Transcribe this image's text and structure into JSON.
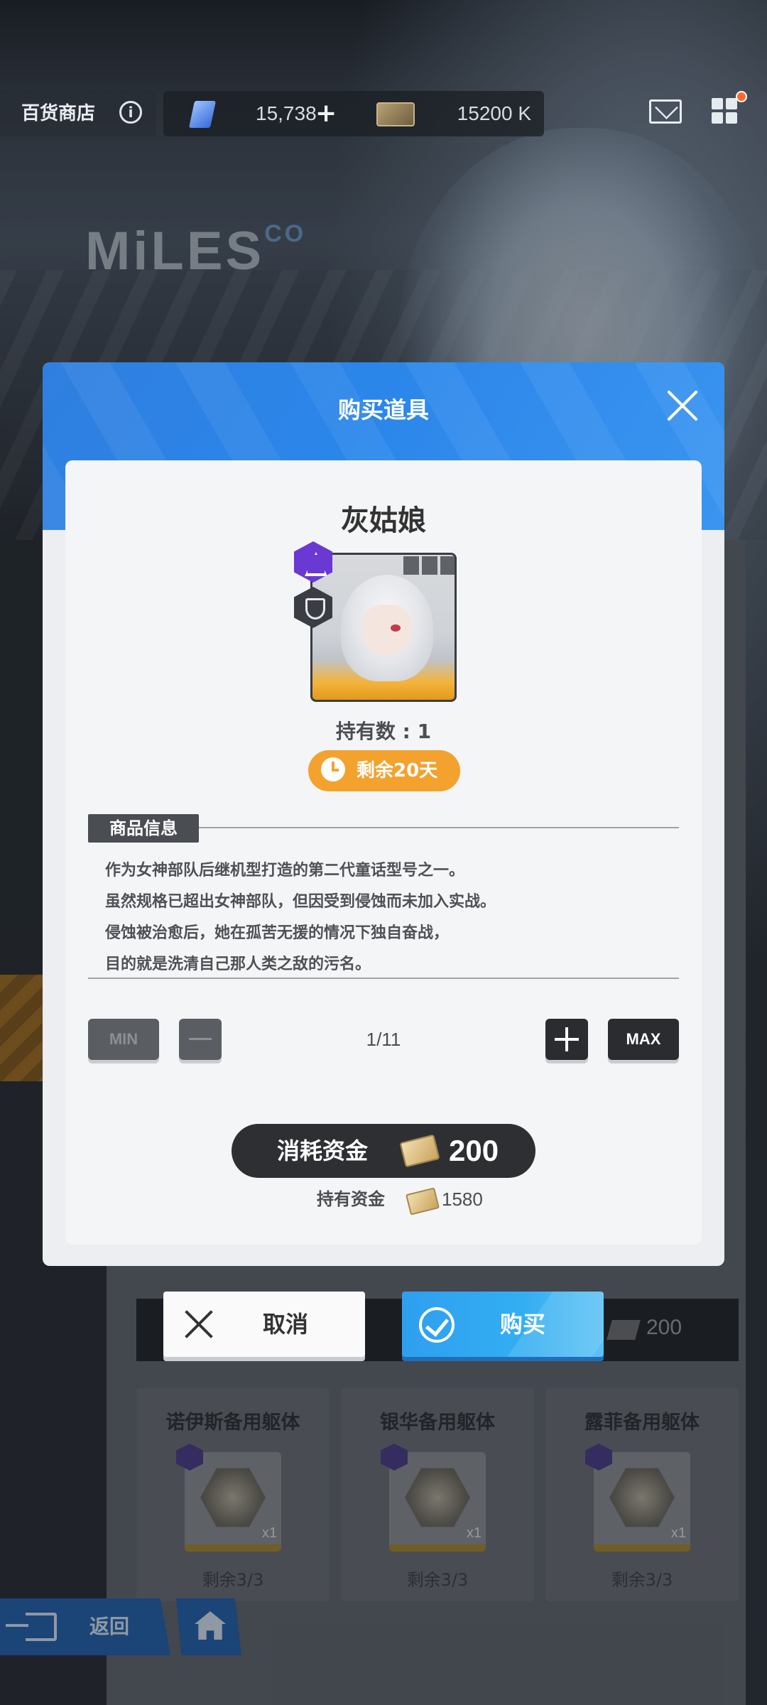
{
  "topbar": {
    "shop_title": "百货商店",
    "gem_amount": "15,738",
    "ticket_amount": "15200 K"
  },
  "background": {
    "logo_text": "MiLES",
    "logo_suffix": "CO"
  },
  "modal": {
    "title": "购买道具",
    "item_name": "灰姑娘",
    "owned_text": "持有数 : 1",
    "remaining_time": "剩余20天",
    "section_label": "商品信息",
    "description": [
      "作为女神部队后继机型打造的第二代童话型号之一。",
      "虽然规格已超出女神部队，但因受到侵蚀而未加入实战。",
      "侵蚀被治愈后，她在孤苦无援的情况下独自奋战，",
      "目的就是洗清自己那人类之敌的污名。"
    ],
    "stepper": {
      "min_label": "MIN",
      "max_label": "MAX",
      "quantity": "1/11"
    },
    "cost_label": "消耗资金",
    "cost_value": "200",
    "funds_label": "持有资金",
    "funds_value": "1580"
  },
  "actions": {
    "cancel_label": "取消",
    "buy_label": "购买"
  },
  "shop_list": {
    "strip_price": "200",
    "cards": [
      {
        "name": "诺伊斯备用躯体",
        "qty": "x1",
        "remain": "剩余3/3"
      },
      {
        "name": "银华备用躯体",
        "qty": "x1",
        "remain": "剩余3/3"
      },
      {
        "name": "露菲备用躯体",
        "qty": "x1",
        "remain": "剩余3/3"
      }
    ]
  },
  "bottom_nav": {
    "back_label": "返回"
  },
  "colors": {
    "modal_header": "#2b86ea",
    "remaining_pill": "#f3a22e",
    "buy_button": "#33aef2"
  }
}
